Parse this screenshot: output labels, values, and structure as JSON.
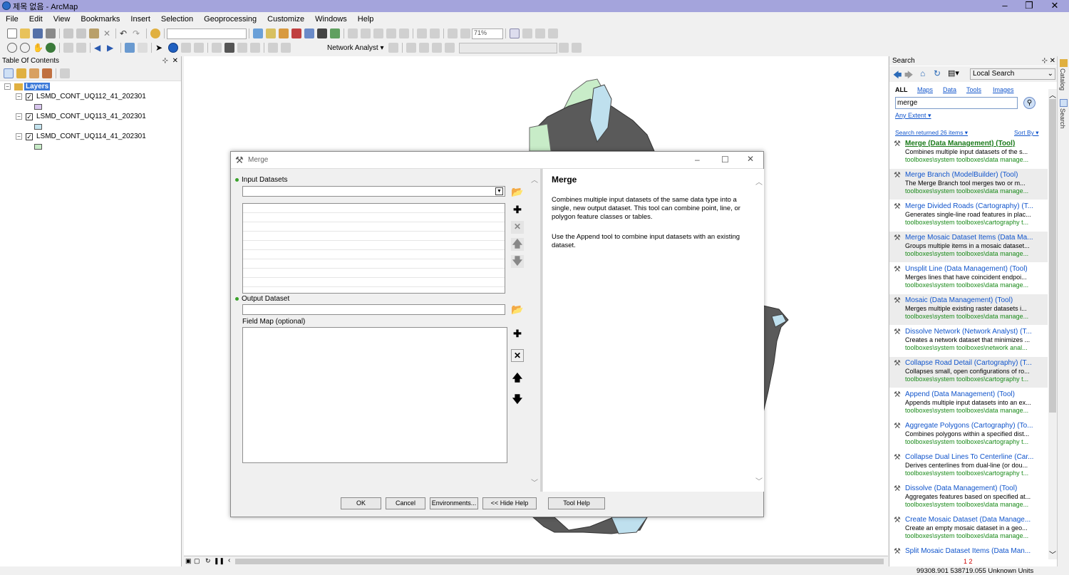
{
  "app": {
    "title": "제목 없음 - ArcMap",
    "minimize": "–",
    "maximize": "❐",
    "close": "✕"
  },
  "menu": [
    "File",
    "Edit",
    "View",
    "Bookmarks",
    "Insert",
    "Selection",
    "Geoprocessing",
    "Customize",
    "Windows",
    "Help"
  ],
  "toolbar": {
    "zoom_value": "71%",
    "network_analyst": "Network Analyst ▾"
  },
  "toc": {
    "title": "Table Of Contents",
    "root": "Layers",
    "layers": [
      {
        "name": "LSMD_CONT_UQ112_41_202301",
        "color": "#d9c7ef"
      },
      {
        "name": "LSMD_CONT_UQ113_41_202301",
        "color": "#c4e4f0"
      },
      {
        "name": "LSMD_CONT_UQ114_41_202301",
        "color": "#c8ecc8"
      }
    ]
  },
  "dialog": {
    "title": "Merge",
    "input_label": "Input Datasets",
    "output_label": "Output Dataset",
    "fieldmap_label": "Field Map (optional)",
    "buttons": {
      "ok": "OK",
      "cancel": "Cancel",
      "env": "Environments...",
      "hide_help": "<< Hide Help",
      "tool_help": "Tool Help"
    },
    "help": {
      "heading": "Merge",
      "p1": "Combines multiple input datasets of the same data type into a single, new output dataset. This tool can combine point, line, or polygon feature classes or tables.",
      "p2": "Use the Append tool to combine input datasets with an existing dataset."
    }
  },
  "search": {
    "title": "Search",
    "scope": "Local Search",
    "tabs": [
      "ALL",
      "Maps",
      "Data",
      "Tools",
      "Images"
    ],
    "query": "merge",
    "extent": "Any Extent ▾",
    "returned": "Search returned 26 items ▾",
    "sort": "Sort By ▾",
    "results": [
      {
        "title": "Merge (Data Management) (Tool)",
        "desc": "Combines multiple input datasets of the s...",
        "path": "toolboxes\\system toolboxes\\data manage..."
      },
      {
        "title": "Merge Branch (ModelBuilder) (Tool)",
        "desc": "The Merge Branch tool merges two or m...",
        "path": "toolboxes\\system toolboxes\\data manage..."
      },
      {
        "title": "Merge Divided Roads (Cartography) (T...",
        "desc": "Generates single-line road features in plac...",
        "path": "toolboxes\\system toolboxes\\cartography t..."
      },
      {
        "title": "Merge Mosaic Dataset Items (Data Ma...",
        "desc": "Groups multiple items in a mosaic dataset...",
        "path": "toolboxes\\system toolboxes\\data manage..."
      },
      {
        "title": "Unsplit Line (Data Management) (Tool)",
        "desc": "Merges lines that have coincident endpoi...",
        "path": "toolboxes\\system toolboxes\\data manage..."
      },
      {
        "title": "Mosaic (Data Management) (Tool)",
        "desc": "Merges multiple existing raster datasets i...",
        "path": "toolboxes\\system toolboxes\\data manage..."
      },
      {
        "title": "Dissolve Network (Network Analyst) (T...",
        "desc": "Creates a network dataset that minimizes ...",
        "path": "toolboxes\\system toolboxes\\network anal..."
      },
      {
        "title": "Collapse Road Detail (Cartography) (T...",
        "desc": "Collapses small, open configurations of ro...",
        "path": "toolboxes\\system toolboxes\\cartography t..."
      },
      {
        "title": "Append (Data Management) (Tool)",
        "desc": "Appends multiple input datasets into an ex...",
        "path": "toolboxes\\system toolboxes\\data manage..."
      },
      {
        "title": "Aggregate Polygons (Cartography) (To...",
        "desc": "Combines polygons within a specified dist...",
        "path": "toolboxes\\system toolboxes\\cartography t..."
      },
      {
        "title": "Collapse Dual Lines To Centerline (Car...",
        "desc": "Derives centerlines from dual-line (or dou...",
        "path": "toolboxes\\system toolboxes\\cartography t..."
      },
      {
        "title": "Dissolve (Data Management) (Tool)",
        "desc": "Aggregates features based on specified at...",
        "path": "toolboxes\\system toolboxes\\data manage..."
      },
      {
        "title": "Create Mosaic Dataset (Data Manage...",
        "desc": "Create an empty mosaic dataset in a geo...",
        "path": "toolboxes\\system toolboxes\\data manage..."
      },
      {
        "title": "Split Mosaic Dataset Items (Data Man...",
        "desc": "",
        "path": ""
      }
    ],
    "pager": "1 2"
  },
  "side_tabs": {
    "catalog": "Catalog",
    "search": "Search"
  },
  "status": {
    "coords": "99308.901  538719.055 Unknown Units"
  }
}
